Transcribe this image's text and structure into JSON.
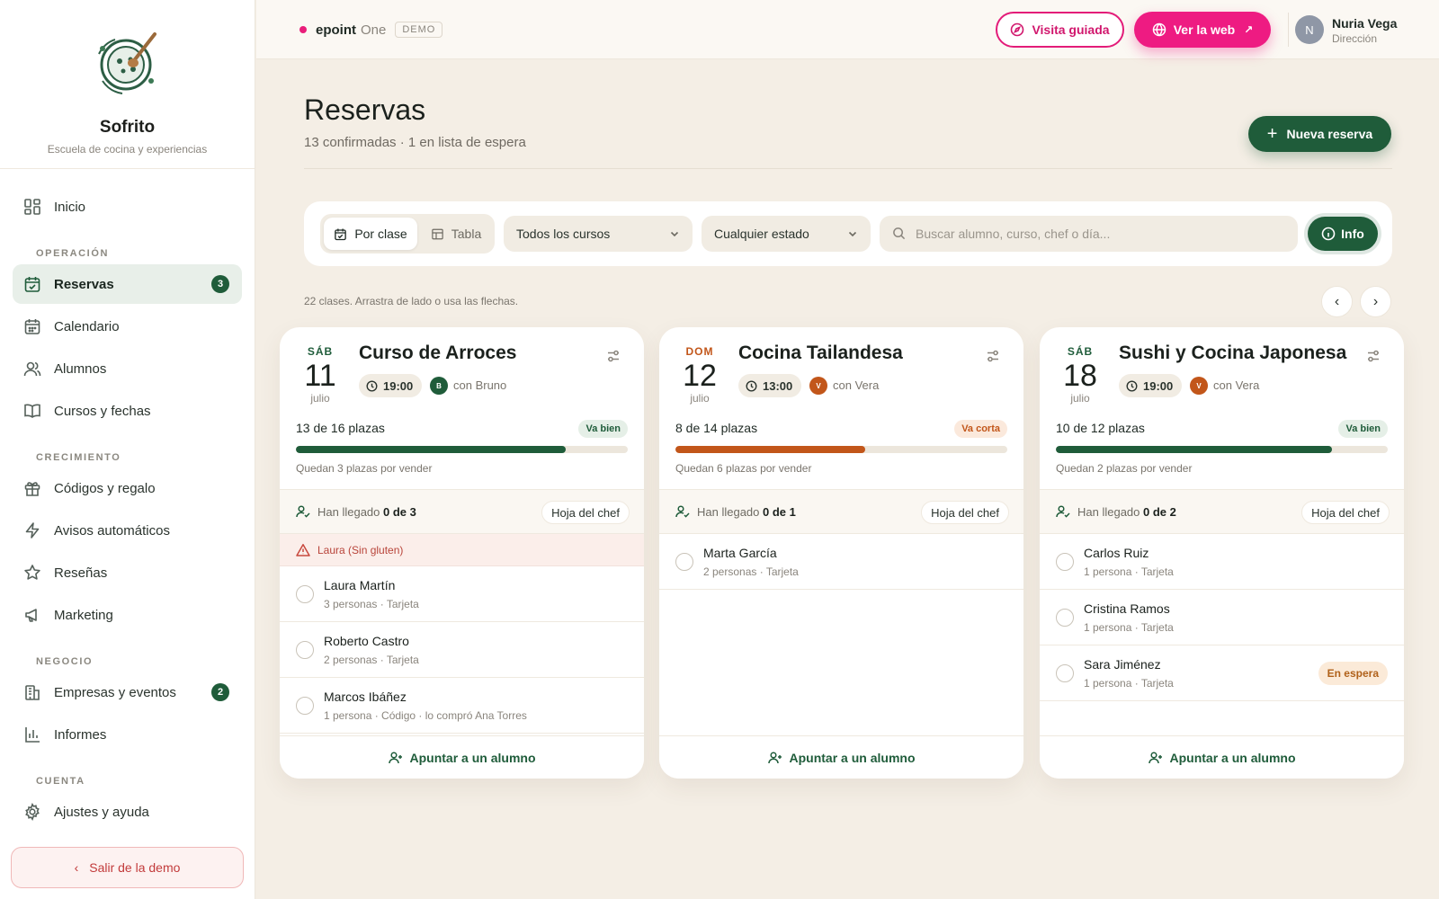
{
  "brand": {
    "name": "Sofrito",
    "subtitle": "Escuela de cocina y experiencias"
  },
  "sidebar": {
    "home": "Inicio",
    "sections": {
      "operacion": "OPERACIÓN",
      "crecimiento": "CRECIMIENTO",
      "negocio": "NEGOCIO",
      "cuenta": "CUENTA"
    },
    "items": {
      "reservas": {
        "label": "Reservas",
        "badge": "3"
      },
      "calendario": {
        "label": "Calendario"
      },
      "alumnos": {
        "label": "Alumnos"
      },
      "cursos": {
        "label": "Cursos y fechas"
      },
      "codigos": {
        "label": "Códigos y regalo"
      },
      "avisos": {
        "label": "Avisos automáticos"
      },
      "resenas": {
        "label": "Reseñas"
      },
      "marketing": {
        "label": "Marketing"
      },
      "empresas": {
        "label": "Empresas y eventos",
        "badge": "2"
      },
      "informes": {
        "label": "Informes"
      },
      "ajustes": {
        "label": "Ajustes y ayuda"
      }
    },
    "exit": "Salir de la demo"
  },
  "topbar": {
    "env_name": "epoint",
    "env_suffix": "One",
    "env_tag": "DEMO",
    "tour": "Visita guiada",
    "web": "Ver la web",
    "user": {
      "initial": "N",
      "name": "Nuria Vega",
      "role": "Dirección"
    }
  },
  "header": {
    "title": "Reservas",
    "subtitle": "13 confirmadas · 1 en lista de espera",
    "new_button": "Nueva reserva"
  },
  "filters": {
    "view_by_class": "Por clase",
    "view_table": "Tabla",
    "course_select": "Todos los cursos",
    "status_select": "Cualquier estado",
    "search_placeholder": "Buscar alumno, curso, chef o día...",
    "info": "Info"
  },
  "hint": "22 clases. Arrastra de lado o usa las flechas.",
  "icons": [
    "dashboard-icon",
    "calendar-check-icon",
    "calendar-icon",
    "users-icon",
    "book-icon",
    "gift-icon",
    "bolt-icon",
    "star-icon",
    "megaphone-icon",
    "building-icon",
    "bar-chart-icon",
    "gear-icon",
    "compass-icon",
    "globe-icon",
    "clock-icon",
    "sliders-icon",
    "user-check-icon",
    "warning-icon",
    "user-plus-icon",
    "search-icon",
    "info-icon"
  ],
  "colors": {
    "brand_green": "#1f5c3a",
    "accent_pink": "#ee1b82",
    "warning_orange": "#c2561a",
    "chef_orange": "#c2561a",
    "chef_green": "#1f5c3a"
  },
  "cards": [
    {
      "dow": "SÁB",
      "day": "11",
      "month": "julio",
      "title": "Curso de Arroces",
      "time": "19:00",
      "chef_initial": "B",
      "chef": "con Bruno",
      "capacity": "13 de 16 plazas",
      "fill_fraction": 0.8125,
      "status": "Va bien",
      "remaining": "Quedan 3 plazas por vender",
      "arrived_label": "Han llegado",
      "arrived_count": "0 de 3",
      "chef_sheet": "Hoja del chef",
      "allergy": "Laura (Sin gluten)",
      "students": [
        {
          "name": "Laura Martín",
          "meta": "3 personas · Tarjeta"
        },
        {
          "name": "Roberto Castro",
          "meta": "2 personas · Tarjeta"
        },
        {
          "name": "Marcos Ibáñez",
          "meta": "1 persona · Código · lo compró Ana Torres"
        }
      ],
      "add": "Apuntar a un alumno"
    },
    {
      "dow": "DOM",
      "day": "12",
      "month": "julio",
      "title": "Cocina Tailandesa",
      "time": "13:00",
      "chef_initial": "V",
      "chef": "con Vera",
      "capacity": "8 de 14 plazas",
      "fill_fraction": 0.5714,
      "status": "Va corta",
      "remaining": "Quedan 6 plazas por vender",
      "arrived_label": "Han llegado",
      "arrived_count": "0 de 1",
      "chef_sheet": "Hoja del chef",
      "students": [
        {
          "name": "Marta García",
          "meta": "2 personas · Tarjeta"
        }
      ],
      "add": "Apuntar a un alumno"
    },
    {
      "dow": "SÁB",
      "day": "18",
      "month": "julio",
      "title": "Sushi y Cocina Japonesa",
      "time": "19:00",
      "chef_initial": "V",
      "chef": "con Vera",
      "capacity": "10 de 12 plazas",
      "fill_fraction": 0.8333,
      "status": "Va bien",
      "remaining": "Quedan 2 plazas por vender",
      "arrived_label": "Han llegado",
      "arrived_count": "0 de 2",
      "chef_sheet": "Hoja del chef",
      "students": [
        {
          "name": "Carlos Ruiz",
          "meta": "1 persona · Tarjeta"
        },
        {
          "name": "Cristina Ramos",
          "meta": "1 persona · Tarjeta"
        },
        {
          "name": "Sara Jiménez",
          "meta": "1 persona · Tarjeta",
          "badge": "En espera"
        }
      ],
      "add": "Apuntar a un alumno"
    }
  ]
}
